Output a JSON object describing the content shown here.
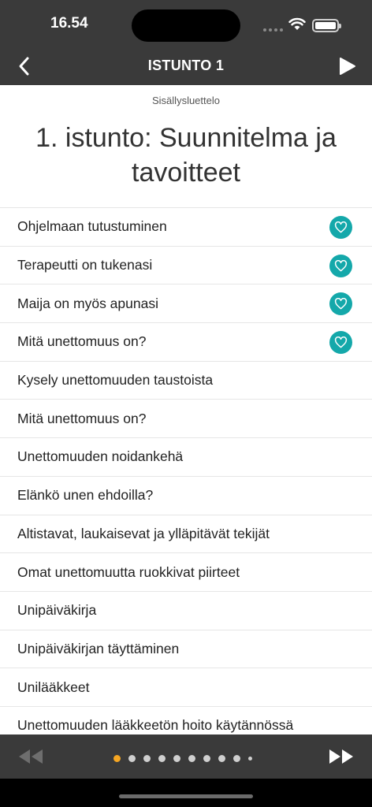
{
  "status": {
    "time": "16.54"
  },
  "nav": {
    "title": "ISTUNTO 1"
  },
  "toc_label": "Sisällysluettelo",
  "page_title": "1. istunto: Suunnitelma ja tavoitteet",
  "colors": {
    "bar": "#3a3a3a",
    "accent": "#14a8aa",
    "active_dot": "#f5a623"
  },
  "items": [
    {
      "label": "Ohjelmaan tutustuminen",
      "completed": true
    },
    {
      "label": "Terapeutti on tukenasi",
      "completed": true
    },
    {
      "label": "Maija on myös apunasi",
      "completed": true
    },
    {
      "label": "Mitä unettomuus on?",
      "completed": true
    },
    {
      "label": "Kysely unettomuuden taustoista",
      "completed": false
    },
    {
      "label": "Mitä unettomuus on?",
      "completed": false
    },
    {
      "label": "Unettomuuden noidankehä",
      "completed": false
    },
    {
      "label": "Elänkö unen ehdoilla?",
      "completed": false
    },
    {
      "label": "Altistavat, laukaisevat ja ylläpitävät tekijät",
      "completed": false
    },
    {
      "label": "Omat unettomuutta ruokkivat piirteet",
      "completed": false
    },
    {
      "label": "Unipäiväkirja",
      "completed": false
    },
    {
      "label": "Unipäiväkirjan täyttäminen",
      "completed": false
    },
    {
      "label": "Unilääkkeet",
      "completed": false
    },
    {
      "label": "Unettomuuden lääkkeetön hoito käytännössä",
      "completed": false
    }
  ],
  "pagination": {
    "total": 10,
    "active": 0
  },
  "icons": {
    "back": "chevron-left-icon",
    "play": "play-icon",
    "rewind": "rewind-icon",
    "forward": "fast-forward-icon",
    "badge": "heart-icon"
  }
}
